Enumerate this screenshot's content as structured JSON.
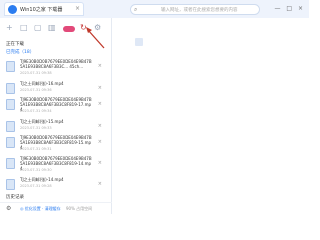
{
  "browser": {
    "tab_title": "Win10之家 下载器",
    "tab_close": "×",
    "tab_caret": "▼",
    "address_placeholder": "输入网址，或者在此搜索您想要的内容",
    "window_controls": "— □ ×"
  },
  "toolbar": {
    "add": "+",
    "folder": "□",
    "copy": "▢",
    "delete": "▥",
    "refresh": "↻",
    "settings": "⚙"
  },
  "section_downloading": "正在下载",
  "section_completed": "已完成（18）",
  "items": [
    {
      "name": "TJ9E30B0D0B7679EE0DE04E9B47B5A1E93B8C8A6F3B3C... 45ch...",
      "meta": "2023-07-31 09:38",
      "close": "×"
    },
    {
      "name": "TJ之士同邮(张)-16.mp4",
      "meta": "2023-07-31 09:36",
      "close": "×"
    },
    {
      "name": "TJ9E30B0D0B7679EE0DE04E9B47B5A1E93B8C8A6F3B3C8F819-17.mp4",
      "meta": "2023-07-31 09:34",
      "close": "×"
    },
    {
      "name": "TJ之士同邮(张)-15.mp4",
      "meta": "2023-07-31 09:33",
      "close": "×"
    },
    {
      "name": "TJ9E30B0D0B7679EE0DE04E9B47B5A1E93B8C8A6F3B3C8F819-15.mp4",
      "meta": "2023-07-31 09:31",
      "close": "×"
    },
    {
      "name": "TJ9E30B0D0B7679EE0DE04E9B47B5A1E93B8C8A6F3B3C8F819-14.mp4",
      "meta": "2023-07-31 09:30",
      "close": "×"
    },
    {
      "name": "TJ之士同邮(张)-14.mp4",
      "meta": "2023-07-31 09:28",
      "close": "×"
    }
  ],
  "section_history": "历史记录",
  "footer": {
    "settings_icon": "⚙",
    "link": "◎ 优化设置 · 清理缓存",
    "info": "90% 占用空间"
  },
  "colors": {
    "accent": "#2a7cf0",
    "record_badge": "#e24a7a"
  }
}
